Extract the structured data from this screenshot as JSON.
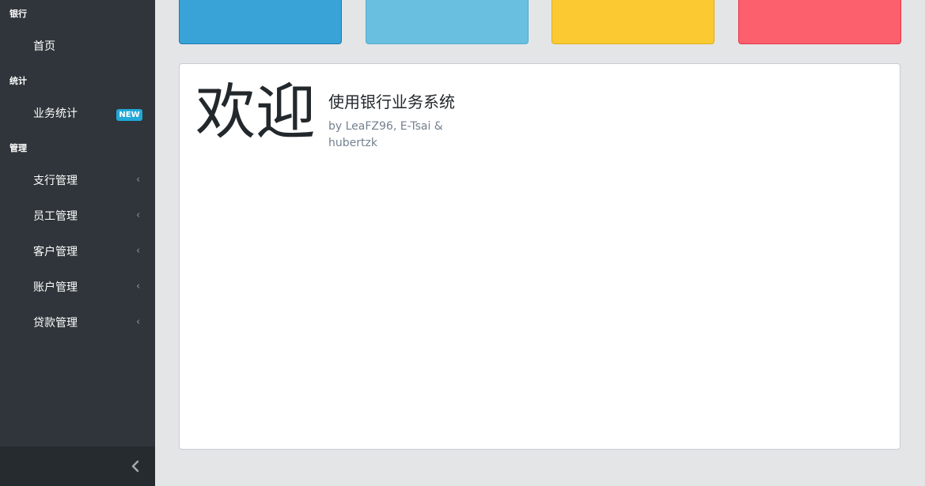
{
  "sidebar": {
    "sections": [
      {
        "title": "银行"
      },
      {
        "title": "统计"
      },
      {
        "title": "管理"
      }
    ],
    "items": [
      {
        "label": "首页"
      },
      {
        "label": "业务统计",
        "badge": "NEW",
        "badge_color": "#20a8d8"
      },
      {
        "label": "支行管理",
        "chevron": "‹"
      },
      {
        "label": "员工管理",
        "chevron": "‹"
      },
      {
        "label": "客户管理",
        "chevron": "‹"
      },
      {
        "label": "账户管理",
        "chevron": "‹"
      },
      {
        "label": "贷款管理",
        "chevron": "‹"
      }
    ],
    "footer_icon": "chevron-left-icon"
  },
  "stat_cards": [
    {
      "color": "#39a3d8"
    },
    {
      "color": "#69bfe0"
    },
    {
      "color": "#fbca33"
    },
    {
      "color": "#fd606d"
    }
  ],
  "welcome": {
    "title": "欢迎",
    "subtitle": "使用银行业务系统",
    "authors": "by LeaFZ96, E-Tsai & hubertzk"
  }
}
